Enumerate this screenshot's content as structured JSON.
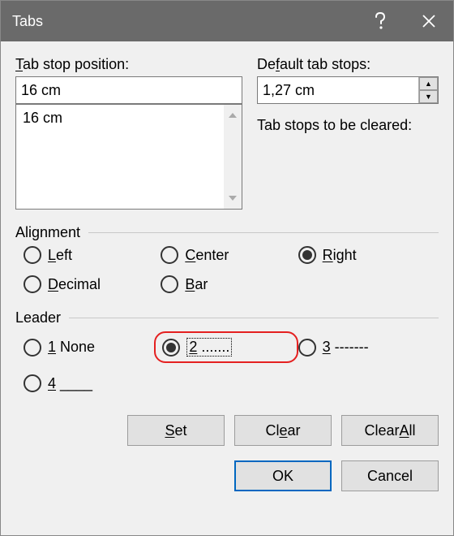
{
  "window": {
    "title": "Tabs"
  },
  "labels": {
    "tab_stop_position": "Tab stop position:",
    "default_tab_stops": "Default tab stops:",
    "tab_stops_cleared": "Tab stops to be cleared:",
    "alignment": "Alignment",
    "leader": "Leader"
  },
  "values": {
    "tab_stop_position_input": "16 cm",
    "tab_stops_list": [
      "16 cm"
    ],
    "default_tab_stops": "1,27 cm"
  },
  "alignment": {
    "left": "Left",
    "center": "Center",
    "right": "Right",
    "decimal": "Decimal",
    "bar": "Bar",
    "selected": "right"
  },
  "leader": {
    "opt1": "1 None",
    "opt2": "2 .......",
    "opt3": "3 -------",
    "opt4": "4 ____",
    "selected": "2"
  },
  "buttons": {
    "set": "Set",
    "clear": "Clear",
    "clear_all": "Clear All",
    "ok": "OK",
    "cancel": "Cancel"
  }
}
